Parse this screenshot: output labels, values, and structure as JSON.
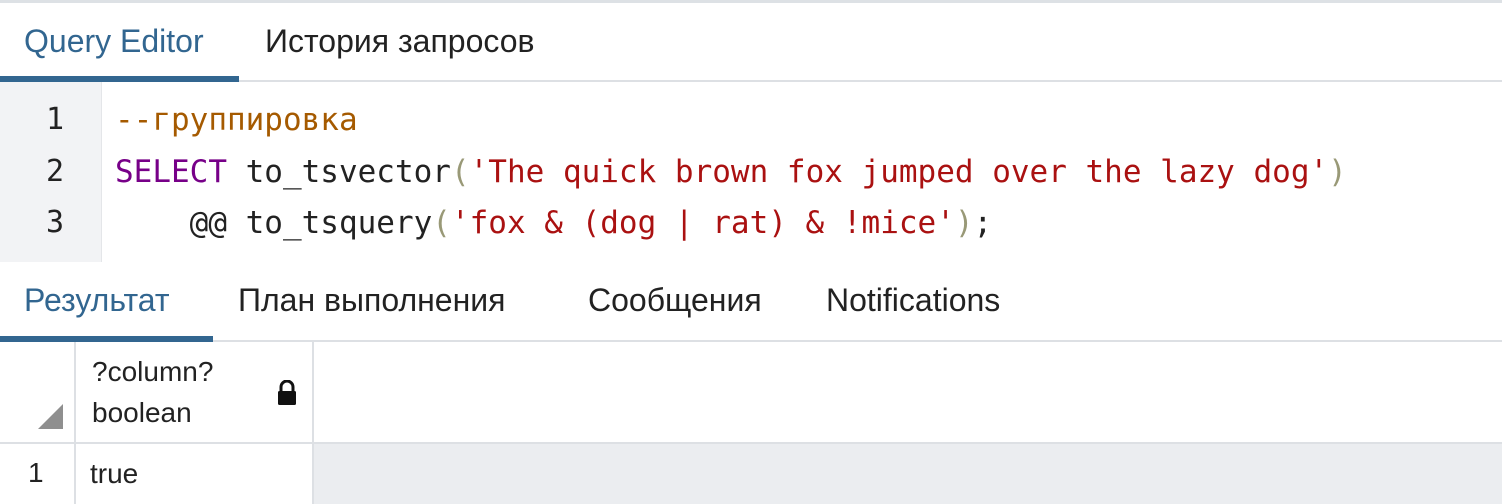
{
  "editor_tabs": [
    {
      "label": "Query Editor",
      "active": true
    },
    {
      "label": "История запросов",
      "active": false
    }
  ],
  "editor": {
    "line_numbers": [
      "1",
      "2",
      "3"
    ],
    "lines": [
      [
        {
          "type": "comment",
          "text": "--группировка"
        }
      ],
      [
        {
          "type": "keyword",
          "text": "SELECT"
        },
        {
          "type": "plain",
          "text": " to_tsvector"
        },
        {
          "type": "bracket",
          "text": "("
        },
        {
          "type": "string",
          "text": "'The quick brown fox jumped over the lazy dog'"
        },
        {
          "type": "bracket",
          "text": ")"
        }
      ],
      [
        {
          "type": "plain",
          "text": "    @@ to_tsquery"
        },
        {
          "type": "bracket",
          "text": "("
        },
        {
          "type": "string",
          "text": "'fox & (dog | rat) & !mice'"
        },
        {
          "type": "bracket",
          "text": ")"
        },
        {
          "type": "plain",
          "text": ";"
        }
      ]
    ]
  },
  "result_tabs": [
    {
      "label": "Результат",
      "active": true
    },
    {
      "label": "План выполнения",
      "active": false
    },
    {
      "label": "Сообщения",
      "active": false
    },
    {
      "label": "Notifications",
      "active": false
    }
  ],
  "grid": {
    "columns": [
      {
        "name": "?column?",
        "type": "boolean",
        "icon": "lock-icon"
      }
    ],
    "rows": [
      {
        "number": "1",
        "values": [
          "true"
        ]
      }
    ]
  },
  "colors": {
    "accent": "#326690",
    "comment": "#a55a00",
    "keyword": "#770088",
    "string": "#aa1111",
    "bracket": "#999977"
  }
}
